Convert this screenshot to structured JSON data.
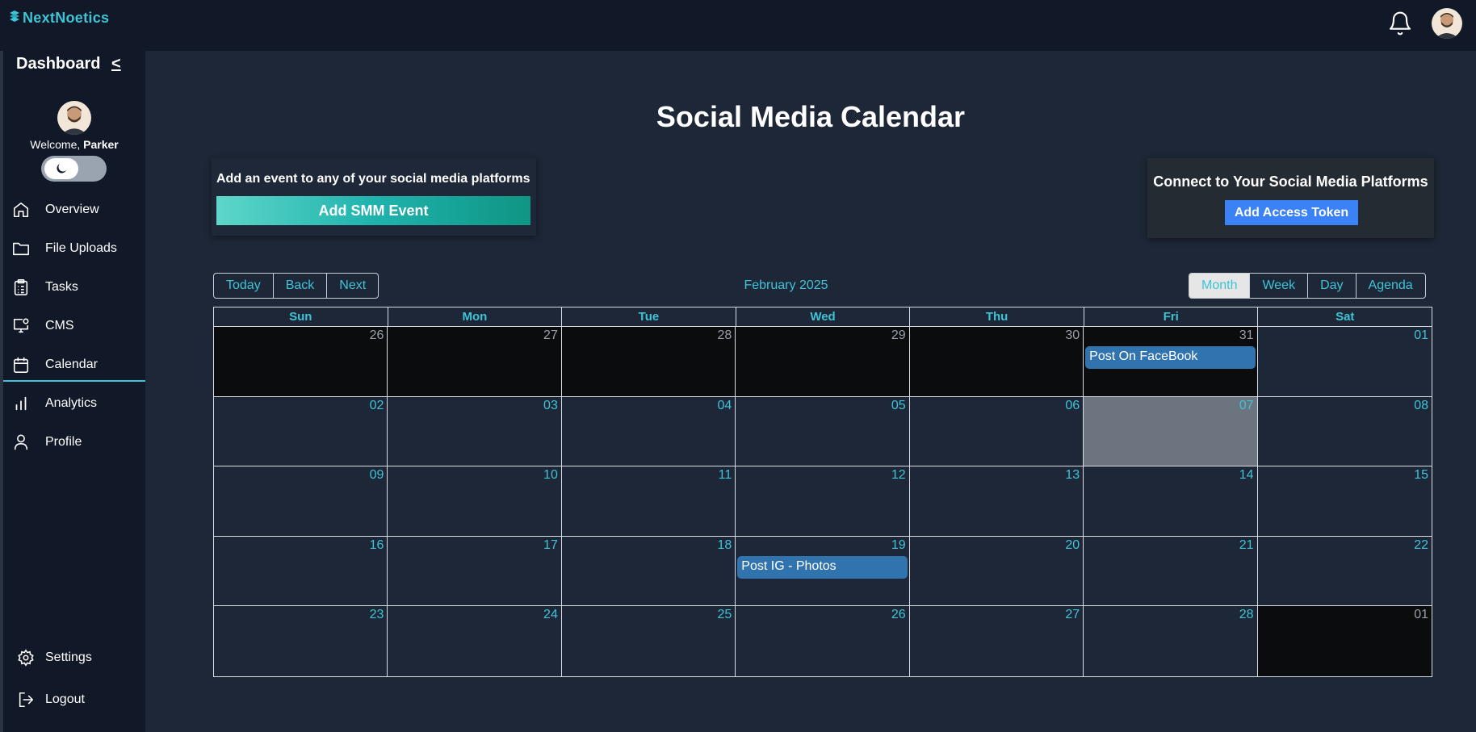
{
  "app": {
    "brand": "NextNoetics"
  },
  "sidebar": {
    "title": "Dashboard",
    "collapse_label": "<",
    "welcome_prefix": "Welcome,",
    "user_name": "Parker",
    "items": [
      {
        "label": "Overview",
        "icon": "home-icon"
      },
      {
        "label": "File Uploads",
        "icon": "folder-icon"
      },
      {
        "label": "Tasks",
        "icon": "clipboard-icon"
      },
      {
        "label": "CMS",
        "icon": "monitor-icon"
      },
      {
        "label": "Calendar",
        "icon": "calendar-icon",
        "active": true
      },
      {
        "label": "Analytics",
        "icon": "bar-chart-icon"
      },
      {
        "label": "Profile",
        "icon": "user-icon"
      }
    ],
    "settings_label": "Settings",
    "logout_label": "Logout"
  },
  "main": {
    "title": "Social Media Calendar",
    "add_event_text": "Add an event to any of your social media platforms",
    "add_event_button": "Add SMM Event",
    "connect_text": "Connect to Your Social Media Platforms",
    "access_token_button": "Add Access Token"
  },
  "calendar": {
    "nav": [
      "Today",
      "Back",
      "Next"
    ],
    "month_label": "February 2025",
    "views": [
      "Month",
      "Week",
      "Day",
      "Agenda"
    ],
    "active_view": "Month",
    "weekdays": [
      "Sun",
      "Mon",
      "Tue",
      "Wed",
      "Thu",
      "Fri",
      "Sat"
    ],
    "weeks": [
      [
        "26",
        "27",
        "28",
        "29",
        "30",
        "31",
        "01"
      ],
      [
        "02",
        "03",
        "04",
        "05",
        "06",
        "07",
        "08"
      ],
      [
        "09",
        "10",
        "11",
        "12",
        "13",
        "14",
        "15"
      ],
      [
        "16",
        "17",
        "18",
        "19",
        "20",
        "21",
        "22"
      ],
      [
        "23",
        "24",
        "25",
        "26",
        "27",
        "28",
        "01"
      ]
    ],
    "events": {
      "Post On FaceBook": "0-5",
      "Post IG - Photos": "3-3"
    },
    "event_labels": [
      "Post On FaceBook",
      "Post IG - Photos"
    ]
  },
  "colors": {
    "accent": "#3fc3d6",
    "event": "#3174ad",
    "today_cell": "#6c7480",
    "off_range_cell": "#0b0c0e",
    "token_button": "#3b82f6"
  }
}
